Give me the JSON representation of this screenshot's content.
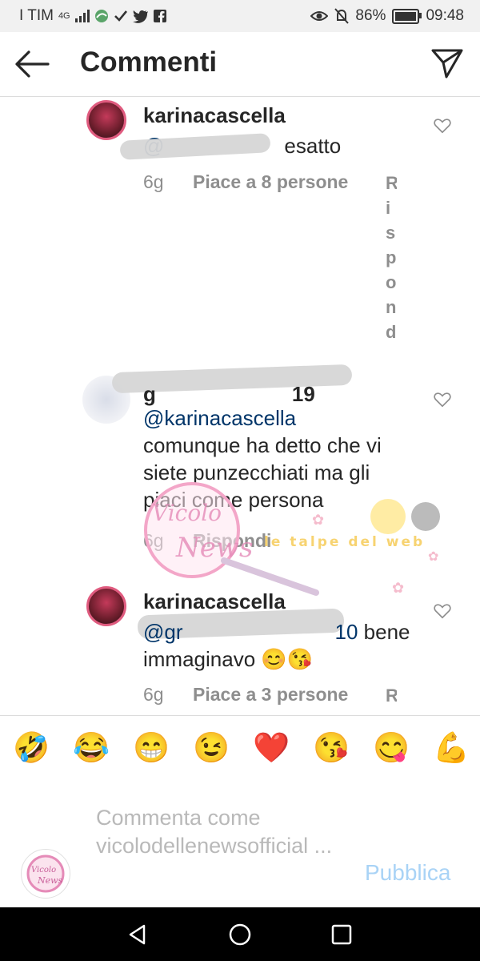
{
  "status_bar": {
    "carrier": "I TIM",
    "network": "4G",
    "battery": "86%",
    "battery_level": 0.86,
    "time": "09:48"
  },
  "header": {
    "title": "Commenti"
  },
  "comments": [
    {
      "username": "karinacascella",
      "mention": "@",
      "text": "esatto",
      "time": "6g",
      "likes": "Piace a 8 persone",
      "reply": "Rispondi"
    },
    {
      "username": "g",
      "username_tail": "19",
      "mention": "@karinacascella",
      "text": "comunque ha detto che vi siete punzecchiati ma gli piaci come persona",
      "time": "6g",
      "reply": "Rispondi"
    },
    {
      "username": "karinacascella",
      "mention": "@gr",
      "mention_tail": "10",
      "text": "bene immaginavo 😊😘",
      "time": "6g",
      "likes": "Piace a 3 persone",
      "reply": "R"
    }
  ],
  "watermark": {
    "logo_text": "Vicolo delle News",
    "banner_text": "le talpe del web"
  },
  "emoji_bar": [
    "🤣",
    "😂",
    "😁",
    "😉",
    "❤️",
    "😘",
    "😋",
    "💪"
  ],
  "composer": {
    "placeholder": "Commenta come vicolodellenewsofficial ...",
    "publish_label": "Pubblica",
    "avatar_text": "Vicolo delle News"
  },
  "colors": {
    "link": "#003569",
    "meta": "#8e8e8e",
    "publish": "#a9d3f6",
    "accent_pink": "#e05b7f"
  }
}
